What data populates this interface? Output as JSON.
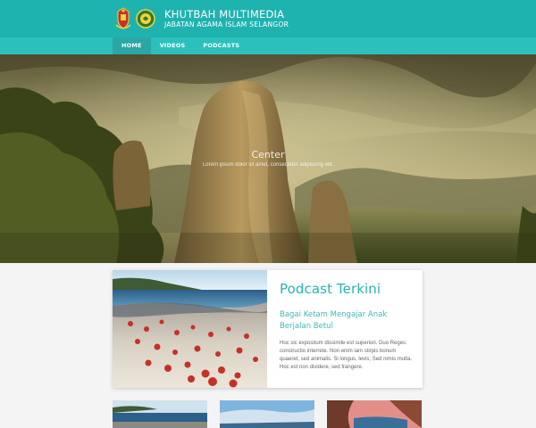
{
  "header": {
    "title": "KHUTBAH MULTIMEDIA",
    "subtitle": "JABATAN AGAMA ISLAM SELANGOR",
    "logos": [
      "state-crest-icon",
      "jais-emblem-icon"
    ]
  },
  "nav": {
    "items": [
      {
        "label": "HOME",
        "active": true
      },
      {
        "label": "VIDEOS",
        "active": false
      },
      {
        "label": "PODCASTS",
        "active": false
      }
    ]
  },
  "hero": {
    "caption_title": "Center",
    "caption_text": "Lorem ipsum dolor sit amet, consectetur adipiscing elit."
  },
  "podcast": {
    "heading": "Podcast Terkini",
    "title": "Bagai Ketam Mengajar Anak Berjalan Betul",
    "description": "Hoc sic expositum dissimile est superiori. Duo Reges: constructio interrete. Non enim iam stirpis bonum quaeret, sed animalis. Si longus, levis; Sed nimis multa. Hoc est non dividere, sed frangere."
  },
  "colors": {
    "header": "#1fb3b0",
    "nav": "#2cc0bd",
    "nav_active": "#2aa7a4",
    "accent_text": "#25b5b2"
  }
}
